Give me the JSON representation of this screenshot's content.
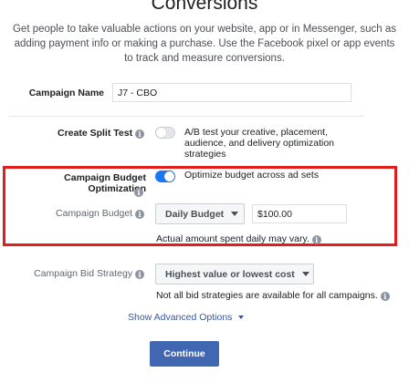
{
  "header": {
    "title": "Conversions",
    "description": "Get people to take valuable actions on your website, app or in Messenger, such as adding payment info or making a purchase. Use the Facebook pixel or app events to track and measure conversions."
  },
  "campaign_name": {
    "label": "Campaign Name",
    "value": "J7 - CBO"
  },
  "split_test": {
    "label": "Create Split Test",
    "description": "A/B test your creative, placement, audience, and delivery optimization strategies"
  },
  "budget_optimization": {
    "label": "Campaign Budget Optimization",
    "toggle_text": "Optimize budget across ad sets",
    "budget_label": "Campaign Budget",
    "budget_type": "Daily Budget",
    "budget_value": "$100.00",
    "note": "Actual amount spent daily may vary."
  },
  "bid_strategy": {
    "label": "Campaign Bid Strategy",
    "selected": "Highest value or lowest cost",
    "note": "Not all bid strategies are available for all campaigns."
  },
  "advanced_options_label": "Show Advanced Options",
  "continue_label": "Continue",
  "colors": {
    "toggle_on": "#1877f2",
    "highlight_border": "#e11d1d",
    "primary_button": "#4267b2"
  }
}
